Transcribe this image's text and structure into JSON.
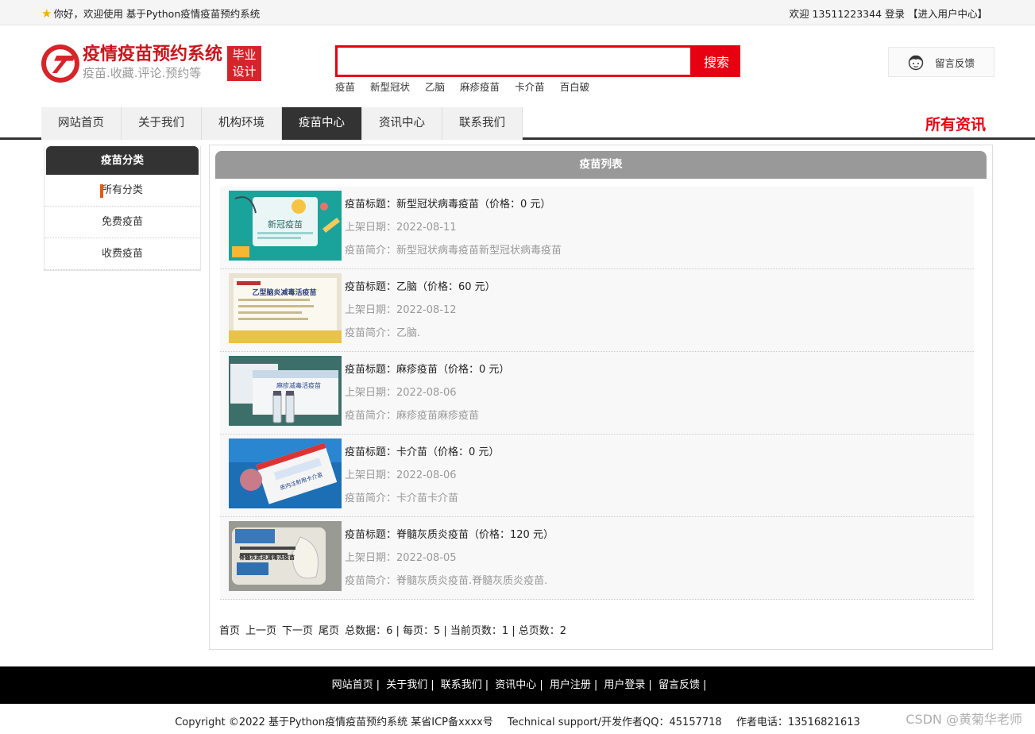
{
  "topbar": {
    "welcome": "你好，欢迎使用 基于Python疫情疫苗预约系统",
    "user_greeting": "欢迎 13511223344 登录",
    "user_center": "【进入用户中心】"
  },
  "logo": {
    "title": "疫情疫苗预约系统",
    "subtitle": "疫苗.收藏.评论.预约等",
    "badge_line1": "毕业",
    "badge_line2": "设计"
  },
  "search": {
    "placeholder": "",
    "button_label": "搜索",
    "hot_words": [
      "疫苗",
      "新型冠状",
      "乙脑",
      "麻疹疫苗",
      "卡介苗",
      "百白破"
    ]
  },
  "feedback": {
    "label": "留言反馈",
    "icon": "face-icon"
  },
  "nav": {
    "items": [
      "网站首页",
      "关于我们",
      "机构环境",
      "疫苗中心",
      "资讯中心",
      "联系我们"
    ],
    "active_index": 3,
    "all_news": "所有资讯"
  },
  "sidebar": {
    "title": "疫苗分类",
    "items": [
      "所有分类",
      "免费疫苗",
      "收费疫苗"
    ]
  },
  "list": {
    "title": "疫苗列表",
    "items": [
      {
        "title": "疫苗标题：新型冠状病毒疫苗（价格：0 元）",
        "date": "上架日期：2022-08-11",
        "desc": "疫苗简介：新型冠状病毒疫苗新型冠状病毒疫苗",
        "thumb_text": "新冠疫苗"
      },
      {
        "title": "疫苗标题：乙脑（价格：60 元）",
        "date": "上架日期：2022-08-12",
        "desc": "疫苗简介：乙脑.",
        "thumb_text": "乙型脑炎减毒活疫苗"
      },
      {
        "title": "疫苗标题：麻疹疫苗（价格：0 元）",
        "date": "上架日期：2022-08-06",
        "desc": "疫苗简介：麻疹疫苗麻疹疫苗",
        "thumb_text": "麻疹减毒活疫苗"
      },
      {
        "title": "疫苗标题：卡介苗（价格：0 元）",
        "date": "上架日期：2022-08-06",
        "desc": "疫苗简介：卡介苗卡介苗",
        "thumb_text": "皮内注射用卡介苗"
      },
      {
        "title": "疫苗标题：脊髓灰质炎疫苗（价格：120 元）",
        "date": "上架日期：2022-08-05",
        "desc": "疫苗简介：脊髓灰质炎疫苗.脊髓灰质炎疫苗.",
        "thumb_text": "脊髓灰质炎减毒活疫苗"
      }
    ]
  },
  "pager": {
    "first": "首页",
    "prev": "上一页",
    "next": "下一页",
    "last": "尾页",
    "summary": "总数据：6 | 每页：5 | 当前页数：1 | 总页数：2"
  },
  "footer": {
    "links": [
      "网站首页",
      "关于我们",
      "联系我们",
      "资讯中心",
      "用户注册",
      "用户登录",
      "留言反馈"
    ]
  },
  "copyright": {
    "text": "Copyright ©2022 基于Python疫情疫苗预约系统 某省ICP备xxxx号",
    "support": "Technical support/开发作者QQ：45157718",
    "phone": "作者电话：13516821613"
  },
  "watermark": "CSDN @黄菊华老师",
  "colors": {
    "accent_red": "#e60012",
    "nav_active": "#333333",
    "list_header": "#999999"
  }
}
